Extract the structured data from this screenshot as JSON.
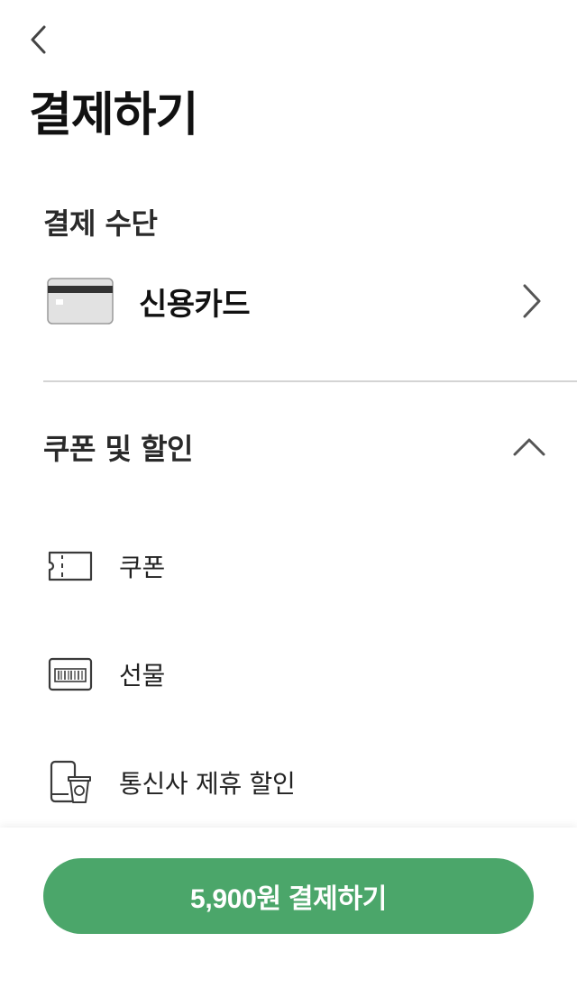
{
  "header": {
    "back_icon": "chevron-left-icon",
    "title": "결제하기"
  },
  "payment_method": {
    "section_label": "결제 수단",
    "selected": {
      "icon": "credit-card-icon",
      "label": "신용카드"
    },
    "chevron_icon": "chevron-right-icon"
  },
  "coupons": {
    "section_label": "쿠폰 및 할인",
    "expanded": true,
    "toggle_icon": "chevron-up-icon",
    "items": [
      {
        "label": "쿠폰",
        "icon": "ticket-icon"
      },
      {
        "label": "선물",
        "icon": "gift-card-icon"
      },
      {
        "label": "통신사 제휴 할인",
        "icon": "phone-cup-icon"
      }
    ]
  },
  "footer": {
    "pay_button_label": "5,900원 결제하기"
  },
  "colors": {
    "accent": "#4ba66a",
    "divider": "#d4d4d4",
    "text": "#1e1e1e"
  }
}
